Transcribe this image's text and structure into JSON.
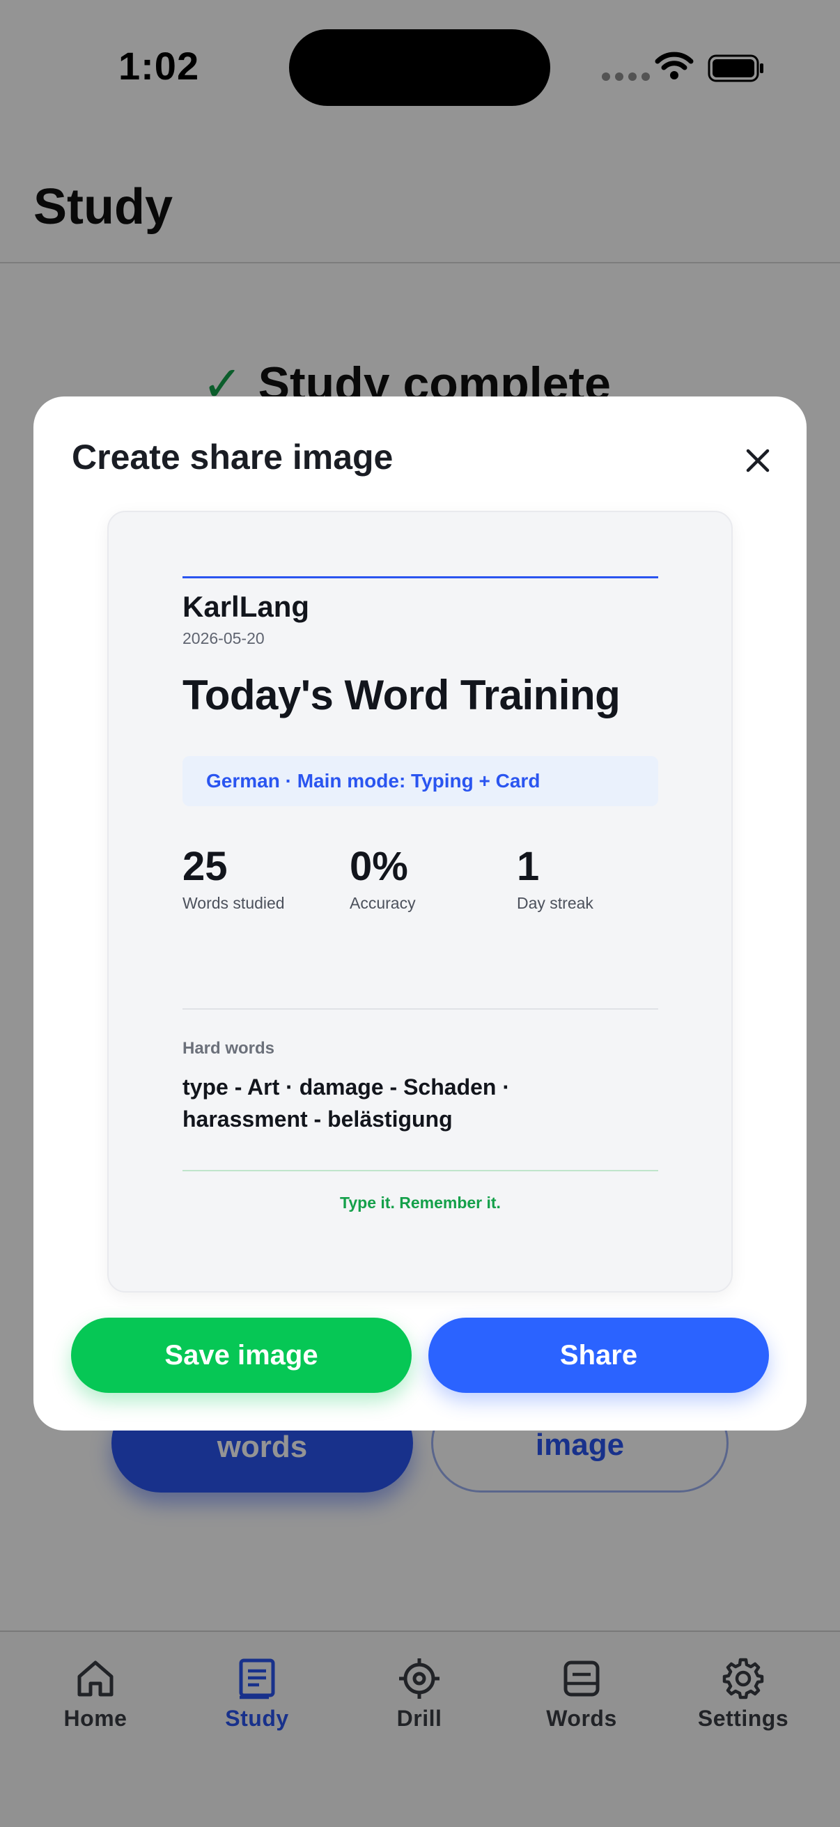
{
  "status_bar": {
    "time": "1:02"
  },
  "header": {
    "title": "Study"
  },
  "background": {
    "complete_title": "Study complete",
    "primary_button_label": "words",
    "secondary_button_label": "image"
  },
  "modal": {
    "title": "Create share image",
    "card": {
      "username": "KarlLang",
      "date": "2026-05-20",
      "headline": "Today's Word Training",
      "mode": "German · Main mode: Typing + Card",
      "stats": [
        {
          "value": "25",
          "label": "Words studied"
        },
        {
          "value": "0%",
          "label": "Accuracy"
        },
        {
          "value": "1",
          "label": "Day streak"
        }
      ],
      "hard_words_label": "Hard words",
      "hard_words": "type - Art · damage - Schaden · harassment - belästigung",
      "tagline": "Type it. Remember it."
    },
    "save_label": "Save image",
    "share_label": "Share"
  },
  "tabs": [
    {
      "label": "Home",
      "icon": "home-icon"
    },
    {
      "label": "Study",
      "icon": "study-icon",
      "active": true
    },
    {
      "label": "Drill",
      "icon": "target-icon"
    },
    {
      "label": "Words",
      "icon": "words-icon"
    },
    {
      "label": "Settings",
      "icon": "gear-icon"
    }
  ],
  "colors": {
    "accent_blue": "#2a55f0",
    "share_blue": "#2b63ff",
    "save_green": "#06c755",
    "tagline_green": "#14a04a"
  }
}
